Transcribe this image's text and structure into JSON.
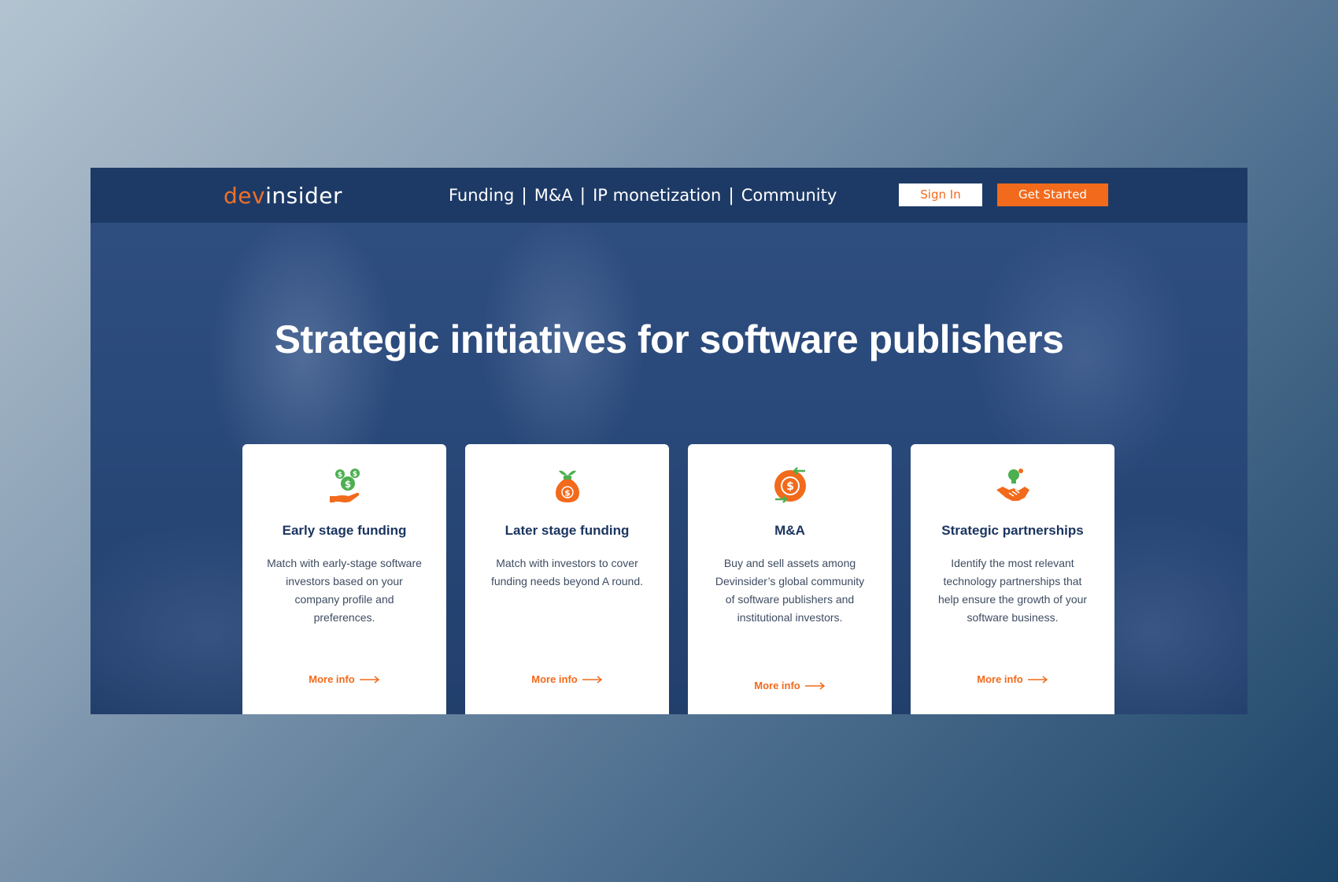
{
  "nav": {
    "logo_dev": "dev",
    "logo_insider": "insider",
    "menu": [
      "Funding",
      "M&A",
      "IP monetization",
      "Community"
    ],
    "separator": "|",
    "signin_label": "Sign In",
    "get_started_label": "Get Started"
  },
  "hero": {
    "headline": "Strategic initiatives for software publishers"
  },
  "cards": [
    {
      "icon": "hand-coins-icon",
      "title": "Early stage funding",
      "description": "Match with early-stage software investors based on your company profile and preferences.",
      "more_label": "More info"
    },
    {
      "icon": "money-bag-sprout-icon",
      "title": "Later stage funding",
      "description": "Match with investors to cover funding needs beyond A round.",
      "more_label": "More info"
    },
    {
      "icon": "currency-exchange-icon",
      "title": "M&A",
      "description": "Buy and sell assets among Devinsider’s global community of software publishers and institutional investors.",
      "more_label": "More info"
    },
    {
      "icon": "handshake-idea-icon",
      "title": "Strategic partnerships",
      "description": "Identify the most relevant technology partnerships that help ensure the growth of your software business.",
      "more_label": "More info"
    }
  ],
  "colors": {
    "accent": "#f26a1b",
    "nav_bg": "#1d3a66",
    "green": "#4caf50",
    "title": "#1b3560"
  }
}
